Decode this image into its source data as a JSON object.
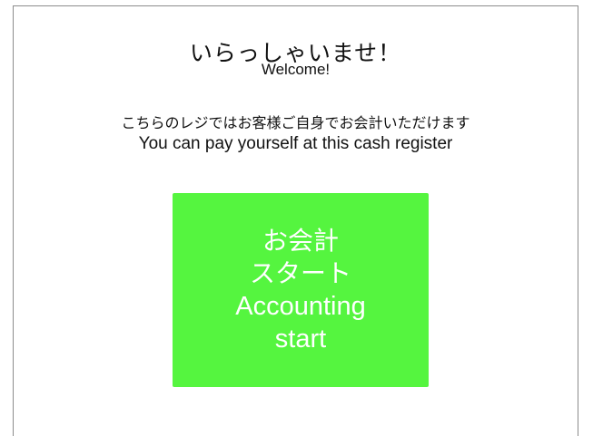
{
  "header": {
    "title_ja": "いらっしゃいませ！",
    "title_en": "Welcome!"
  },
  "info": {
    "text_ja": "こちらのレジではお客様ご自身でお会計いただけます",
    "text_en": "You can pay yourself at this cash register"
  },
  "start_button": {
    "line1": "お会計",
    "line2": "スタート",
    "line3": "Accounting",
    "line4": "start",
    "color": "#55f53f"
  }
}
